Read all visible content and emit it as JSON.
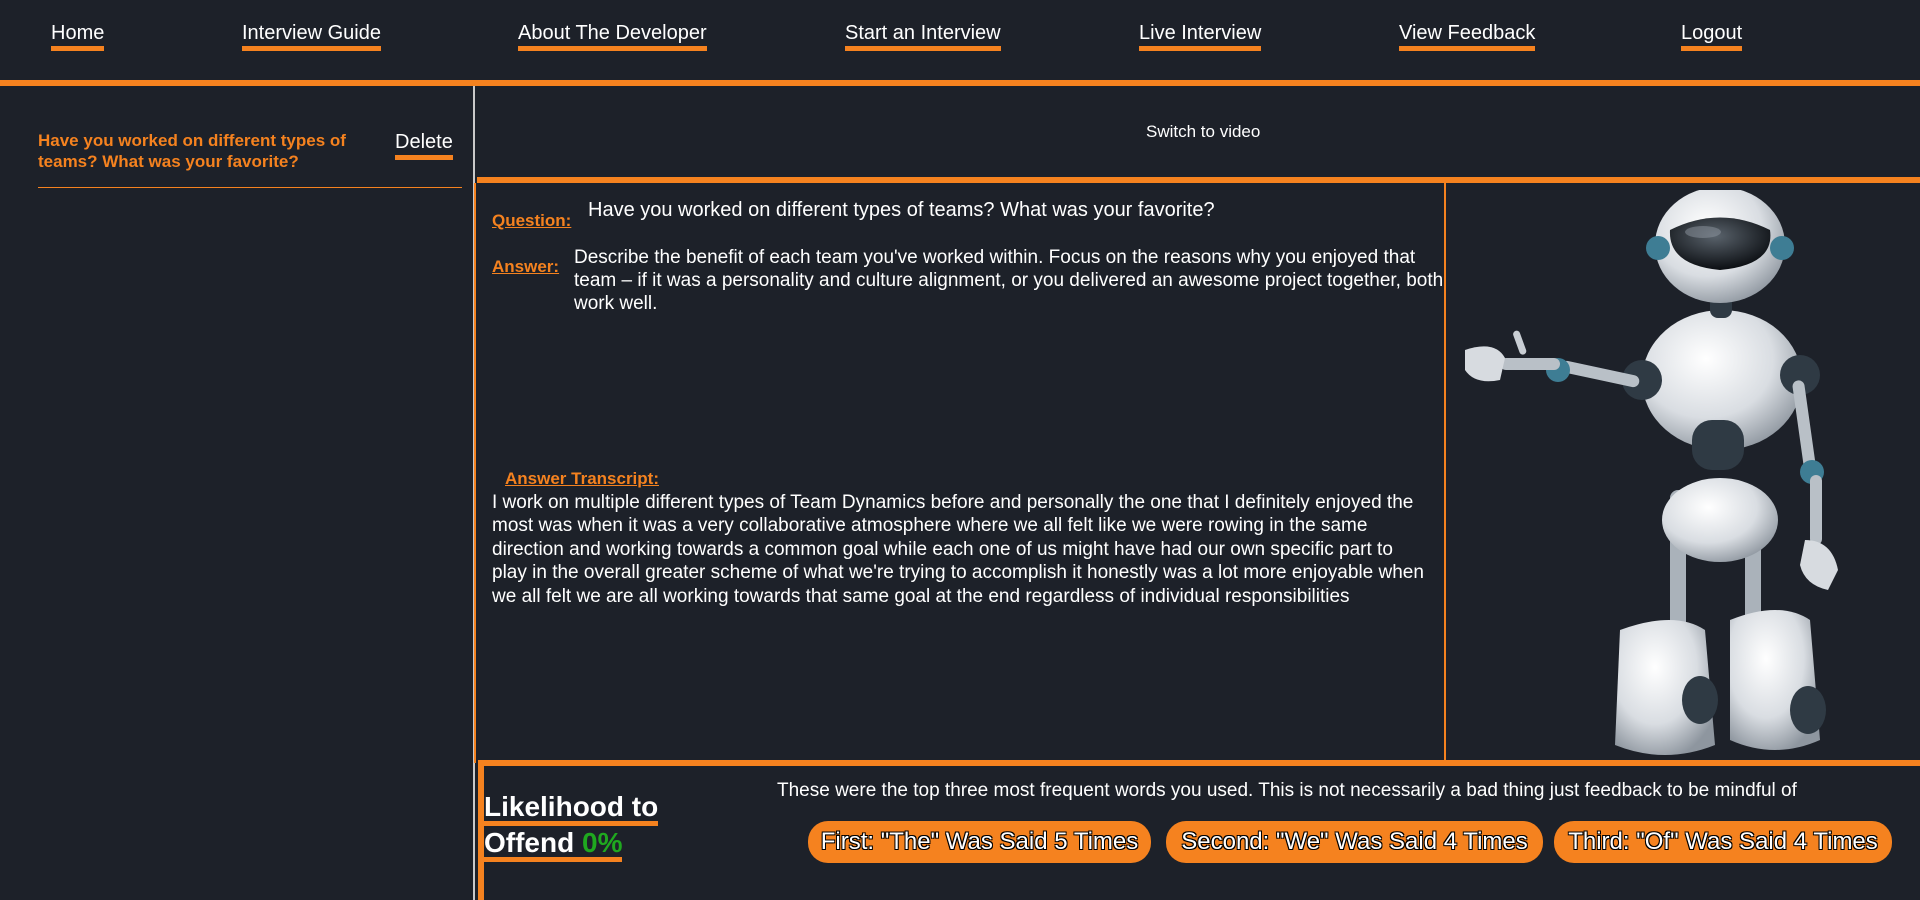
{
  "nav": {
    "home": "Home",
    "interview_guide": "Interview Guide",
    "about": "About The Developer",
    "start": "Start an Interview",
    "live": "Live Interview",
    "feedback": "View Feedback",
    "logout": "Logout"
  },
  "sidebar": {
    "items": [
      {
        "question": "Have you worked on different types of teams? What was your favorite?",
        "delete_label": "Delete"
      }
    ]
  },
  "switch_label": "Switch to video",
  "qa": {
    "question_label": "Question:",
    "question": "Have you worked on different types of teams? What was your favorite?",
    "answer_label": "Answer:",
    "answer": "Describe the benefit of each team you've worked within. Focus on the reasons why you enjoyed that team – if it was a personality and culture alignment, or you delivered an awesome project together, both work well.",
    "transcript_label": "Answer Transcript:",
    "transcript": "I work on multiple different types of Team Dynamics before and personally the one that I definitely enjoyed the most was when it was a very collaborative atmosphere where we all felt like we were rowing in the same direction and working towards a common goal while each one of us might have had our own specific part to play in the overall greater scheme of what we're trying to accomplish it honestly was a lot more enjoyable when we all felt we are all working towards that same goal at the end regardless of individual responsibilities"
  },
  "offend": {
    "line1": "Likelihood to",
    "line2": "Offend",
    "percent": "0%"
  },
  "words": {
    "intro": "These were the top three most frequent words you used. This is not necessarily a bad thing just feedback to be mindful of",
    "first": "First: \"The\" Was Said 5 Times",
    "second": "Second: \"We\" Was Said 4 Times",
    "third": "Third: \"Of\" Was Said 4 Times"
  },
  "colors": {
    "accent": "#f5821f",
    "background": "#1d2129",
    "percent_green": "#1fa81f"
  }
}
